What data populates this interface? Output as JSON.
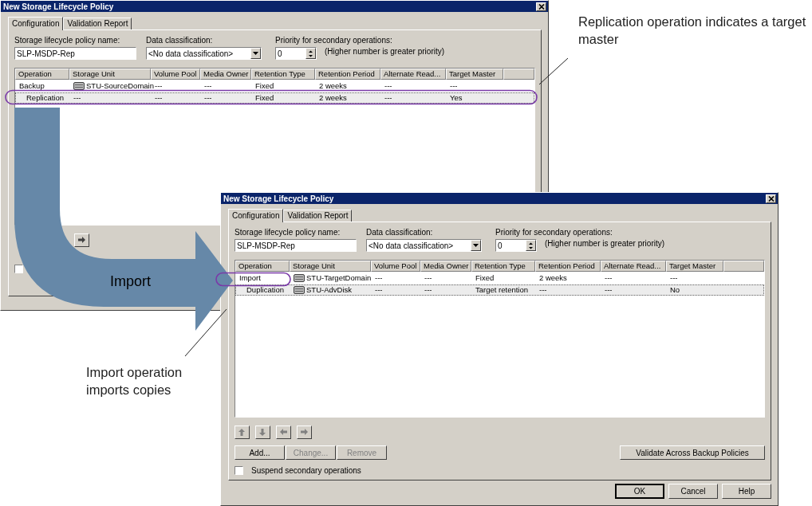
{
  "windows": [
    {
      "title": "New Storage Lifecycle Policy",
      "tabs": [
        {
          "label": "Configuration",
          "selected": true
        },
        {
          "label": "Validation Report",
          "selected": false
        }
      ],
      "name_field": {
        "label": "Storage lifecycle policy name:",
        "value": "SLP-MSDP-Rep"
      },
      "classification": {
        "label": "Data classification:",
        "value": "<No data classification>"
      },
      "priority": {
        "label": "Priority for secondary operations:",
        "value": "0",
        "hint": "(Higher number is greater priority)"
      },
      "table": {
        "columns": [
          "Operation",
          "Storage Unit",
          "Volume Pool",
          "Media Owner",
          "Retention Type",
          "Retention Period",
          "Alternate Read...",
          "Target Master"
        ],
        "rows": [
          {
            "selected": false,
            "has_icon": true,
            "cells": [
              "Backup",
              "STU-SourceDomain",
              "---",
              "---",
              "Fixed",
              "2 weeks",
              "---",
              "---"
            ],
            "children": [
              {
                "selected": true,
                "has_icon": false,
                "cells": [
                  "Replication",
                  "---",
                  "---",
                  "---",
                  "Fixed",
                  "2 weeks",
                  "---",
                  "Yes"
                ]
              }
            ]
          }
        ]
      },
      "move_buttons": [
        {
          "kind": "right",
          "disabled": false
        }
      ],
      "suspend_checkbox": {
        "checked": false
      }
    },
    {
      "title": "New Storage Lifecycle Policy",
      "tabs": [
        {
          "label": "Configuration",
          "selected": true
        },
        {
          "label": "Validation Report",
          "selected": false
        }
      ],
      "name_field": {
        "label": "Storage lifecycle policy name:",
        "value": "SLP-MSDP-Rep"
      },
      "classification": {
        "label": "Data classification:",
        "value": "<No data classification>"
      },
      "priority": {
        "label": "Priority for secondary operations:",
        "value": "0",
        "hint": "(Higher number is greater priority)"
      },
      "table": {
        "columns": [
          "Operation",
          "Storage Unit",
          "Volume Pool",
          "Media Owner",
          "Retention Type",
          "Retention Period",
          "Alternate Read...",
          "Target Master"
        ],
        "rows": [
          {
            "selected": false,
            "has_icon": true,
            "cells": [
              "Import",
              "STU-TargetDomain",
              "---",
              "---",
              "Fixed",
              "2 weeks",
              "---",
              "---"
            ],
            "children": [
              {
                "selected": true,
                "has_icon": true,
                "cells": [
                  "Duplication",
                  "STU-AdvDisk",
                  "---",
                  "---",
                  "Target retention",
                  "---",
                  "---",
                  "No"
                ]
              }
            ]
          }
        ]
      },
      "move_buttons": [
        {
          "kind": "up",
          "disabled": true
        },
        {
          "kind": "down",
          "disabled": true
        },
        {
          "kind": "left",
          "disabled": true
        },
        {
          "kind": "right",
          "disabled": true
        }
      ],
      "action_buttons": [
        {
          "label": "Add...",
          "disabled": false
        },
        {
          "label": "Change...",
          "disabled": true
        },
        {
          "label": "Remove",
          "disabled": true
        }
      ],
      "validate_button": {
        "label": "Validate Across Backup Policies"
      },
      "suspend_checkbox": {
        "checked": false,
        "label": "Suspend secondary operations"
      },
      "dialog_buttons": [
        {
          "label": "OK",
          "default": true
        },
        {
          "label": "Cancel",
          "default": false
        },
        {
          "label": "Help",
          "default": false
        }
      ]
    }
  ],
  "arrow_label": "Import",
  "callouts": [
    {
      "text": "Replication operation indicates a target master"
    },
    {
      "text": "Import operation imports copies"
    }
  ]
}
